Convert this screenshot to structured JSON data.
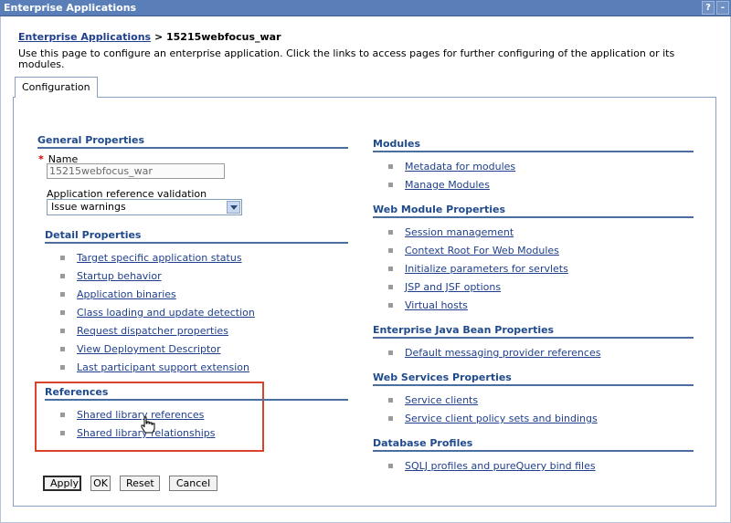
{
  "window": {
    "title": "Enterprise Applications",
    "help_label": "?",
    "minimize_label": "-"
  },
  "breadcrumb": {
    "parent": "Enterprise Applications",
    "separator": " > ",
    "current": "15215webfocus_war"
  },
  "description": "Use this page to configure an enterprise application. Click the links to access pages for further configuring of the application or its modules.",
  "tabs": [
    "Configuration"
  ],
  "general_properties": {
    "heading": "General Properties",
    "name_required_marker": "*",
    "name_label": "Name",
    "name_value": "15215webfocus_war",
    "validation_label": "Application reference validation",
    "validation_value": "Issue warnings"
  },
  "detail_properties": {
    "heading": "Detail Properties",
    "links": [
      "Target specific application status",
      "Startup behavior",
      "Application binaries",
      "Class loading and update detection",
      "Request dispatcher properties",
      "View Deployment Descriptor",
      "Last participant support extension"
    ]
  },
  "references": {
    "heading": "References",
    "links": [
      "Shared library references",
      "Shared library relationships"
    ]
  },
  "modules": {
    "heading": "Modules",
    "links": [
      "Metadata for modules",
      "Manage Modules"
    ]
  },
  "web_module_properties": {
    "heading": "Web Module Properties",
    "links": [
      "Session management",
      "Context Root For Web Modules",
      "Initialize parameters for servlets",
      "JSP and JSF options",
      "Virtual hosts"
    ]
  },
  "ejb_properties": {
    "heading": "Enterprise Java Bean Properties",
    "links": [
      "Default messaging provider references"
    ]
  },
  "web_services_properties": {
    "heading": "Web Services Properties",
    "links": [
      "Service clients",
      "Service client policy sets and bindings"
    ]
  },
  "database_profiles": {
    "heading": "Database Profiles",
    "links": [
      "SQLJ profiles and pureQuery bind files"
    ]
  },
  "buttons": {
    "apply": "Apply",
    "ok": "OK",
    "reset": "Reset",
    "cancel": "Cancel"
  },
  "colors": {
    "titlebar": "#5a7fb8",
    "section_heading": "#1f4a8c",
    "link": "#1f3f8c",
    "highlight": "#d9422b"
  }
}
